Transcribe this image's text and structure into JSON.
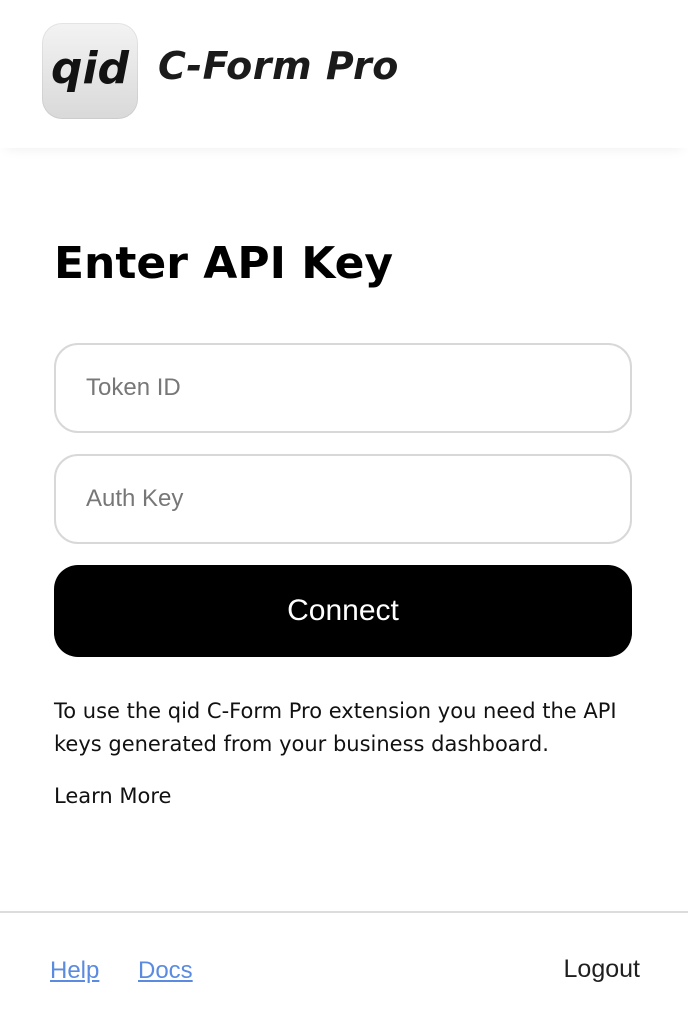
{
  "header": {
    "logo_text": "qid",
    "title": "C-Form Pro"
  },
  "main": {
    "title": "Enter API Key",
    "token_field": {
      "placeholder": "Token ID",
      "value": ""
    },
    "auth_field": {
      "placeholder": "Auth Key",
      "value": ""
    },
    "connect_label": "Connect",
    "info_text": "To use the qid C-Form Pro extension you need the API keys generated from your business dashboard.",
    "learn_more_label": "Learn More"
  },
  "footer": {
    "help_label": "Help",
    "docs_label": "Docs",
    "logout_label": "Logout"
  },
  "colors": {
    "primary_button": "#000000",
    "link": "#5b8be0",
    "border": "#d8d8d8"
  },
  "icons": {
    "logo": "qid-logo-icon"
  }
}
